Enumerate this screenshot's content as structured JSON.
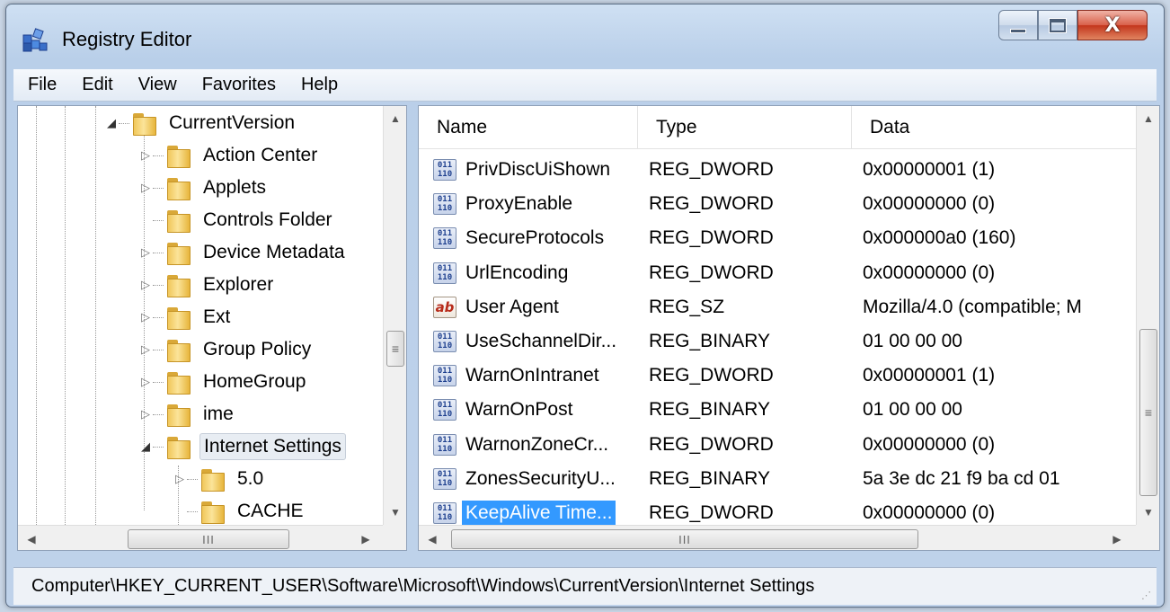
{
  "window": {
    "title": "Registry Editor",
    "close_glyph": "X"
  },
  "menu": [
    "File",
    "Edit",
    "View",
    "Favorites",
    "Help"
  ],
  "tree": {
    "items": [
      {
        "label": "CurrentVersion",
        "expander": "◢"
      },
      {
        "label": "Action Center",
        "expander": "▷"
      },
      {
        "label": "Applets",
        "expander": "▷"
      },
      {
        "label": "Controls Folder",
        "expander": ""
      },
      {
        "label": "Device Metadata",
        "expander": "▷"
      },
      {
        "label": "Explorer",
        "expander": "▷"
      },
      {
        "label": "Ext",
        "expander": "▷"
      },
      {
        "label": "Group Policy",
        "expander": "▷"
      },
      {
        "label": "HomeGroup",
        "expander": "▷"
      },
      {
        "label": "ime",
        "expander": "▷"
      },
      {
        "label": "Internet Settings",
        "expander": "◢"
      },
      {
        "label": "5.0",
        "expander": "▷"
      },
      {
        "label": "CACHE",
        "expander": ""
      }
    ],
    "hscroll_grip": "III"
  },
  "list": {
    "columns": [
      "Name",
      "Type",
      "Data"
    ],
    "rows": [
      {
        "icon": "dword",
        "name": "PrivDiscUiShown",
        "type": "REG_DWORD",
        "data": "0x00000001 (1)"
      },
      {
        "icon": "dword",
        "name": "ProxyEnable",
        "type": "REG_DWORD",
        "data": "0x00000000 (0)"
      },
      {
        "icon": "dword",
        "name": "SecureProtocols",
        "type": "REG_DWORD",
        "data": "0x000000a0 (160)"
      },
      {
        "icon": "dword",
        "name": "UrlEncoding",
        "type": "REG_DWORD",
        "data": "0x00000000 (0)"
      },
      {
        "icon": "sz",
        "name": "User Agent",
        "type": "REG_SZ",
        "data": "Mozilla/4.0 (compatible; M"
      },
      {
        "icon": "dword",
        "name": "UseSchannelDir...",
        "type": "REG_BINARY",
        "data": "01 00 00 00"
      },
      {
        "icon": "dword",
        "name": "WarnOnIntranet",
        "type": "REG_DWORD",
        "data": "0x00000001 (1)"
      },
      {
        "icon": "dword",
        "name": "WarnOnPost",
        "type": "REG_BINARY",
        "data": "01 00 00 00"
      },
      {
        "icon": "dword",
        "name": "WarnonZoneCr...",
        "type": "REG_DWORD",
        "data": "0x00000000 (0)"
      },
      {
        "icon": "dword",
        "name": "ZonesSecurityU...",
        "type": "REG_BINARY",
        "data": "5a 3e dc 21 f9 ba cd 01"
      },
      {
        "icon": "dword",
        "name": "KeepAlive Time...",
        "type": "REG_DWORD",
        "data": "0x00000000 (0)"
      }
    ],
    "icon_text": {
      "dword": "011\n110",
      "sz": "ab"
    },
    "hscroll_grip": "III"
  },
  "status": {
    "path": "Computer\\HKEY_CURRENT_USER\\Software\\Microsoft\\Windows\\CurrentVersion\\Internet Settings"
  },
  "colors": {
    "selection": "#3399ff",
    "title_bar": "#b9cfe9",
    "close_button": "#c3351c"
  }
}
